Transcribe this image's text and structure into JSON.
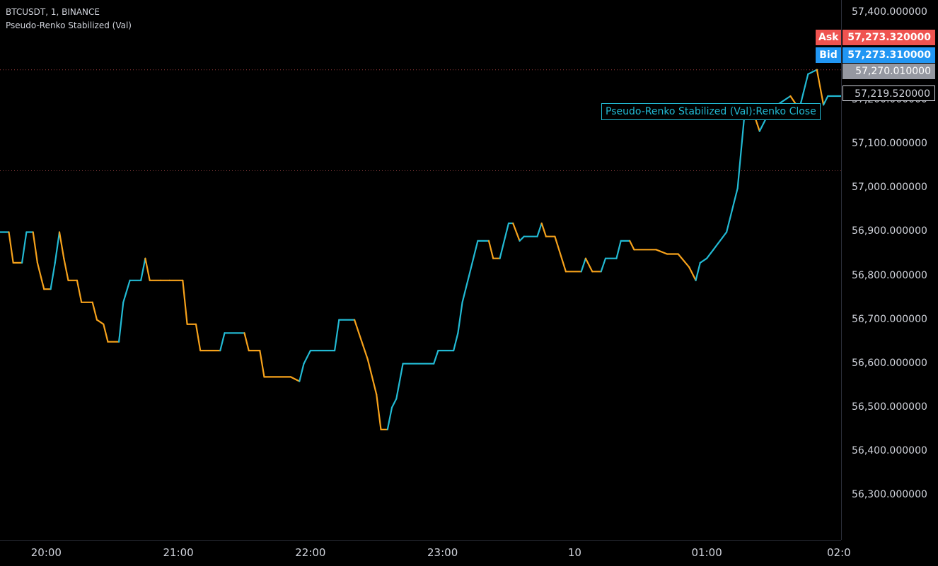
{
  "header": {
    "symbol_line": "BTCUSDT, 1, BINANCE",
    "indicator_line": "Pseudo-Renko Stabilized (Val)"
  },
  "price_scale": {
    "labels": [
      "57,400.000000",
      "57,200.000000",
      "57,100.000000",
      "57,000.000000",
      "56,900.000000",
      "56,800.000000",
      "56,700.000000",
      "56,600.000000",
      "56,500.000000",
      "56,400.000000",
      "56,300.000000"
    ]
  },
  "time_scale": {
    "labels": [
      "20:00",
      "21:00",
      "22:00",
      "23:00",
      "10",
      "01:00",
      "02:0"
    ]
  },
  "tags": {
    "ask_label": "Ask",
    "ask_price": "57,273.320000",
    "bid_label": "Bid",
    "bid_price": "57,273.310000",
    "last_price": "57,270.010000",
    "renko_price": "57,219.520000",
    "renko_callout": "Pseudo-Renko Stabilized (Val):Renko Close"
  },
  "colors": {
    "background": "#000000",
    "renko_up": "#22bad4",
    "renko_down": "#f7a21b",
    "ask": "#ef5350",
    "bid": "#2196f3",
    "last": "#9598a1"
  },
  "chart_data": {
    "type": "line",
    "title": "",
    "xlabel": "",
    "ylabel": "",
    "ylim": [
      56230,
      57430
    ],
    "xlim": [
      "19:39",
      "02:01"
    ],
    "renko_close": [
      [
        "19:39",
        56900
      ],
      [
        "19:43",
        56900
      ],
      [
        "19:45",
        56830
      ],
      [
        "19:49",
        56830
      ],
      [
        "19:51",
        56900
      ],
      [
        "19:54",
        56900
      ],
      [
        "19:56",
        56830
      ],
      [
        "19:58",
        56790
      ],
      [
        "19:59",
        56770
      ],
      [
        "20:02",
        56770
      ],
      [
        "20:04",
        56830
      ],
      [
        "20:06",
        56900
      ],
      [
        "20:08",
        56840
      ],
      [
        "20:10",
        56790
      ],
      [
        "20:14",
        56790
      ],
      [
        "20:16",
        56740
      ],
      [
        "20:21",
        56740
      ],
      [
        "20:23",
        56700
      ],
      [
        "20:26",
        56690
      ],
      [
        "20:28",
        56650
      ],
      [
        "20:33",
        56650
      ],
      [
        "20:35",
        56740
      ],
      [
        "20:38",
        56790
      ],
      [
        "20:43",
        56790
      ],
      [
        "20:45",
        56840
      ],
      [
        "20:47",
        56790
      ],
      [
        "20:52",
        56790
      ],
      [
        "20:56",
        56790
      ],
      [
        "21:02",
        56790
      ],
      [
        "21:04",
        56690
      ],
      [
        "21:08",
        56690
      ],
      [
        "21:10",
        56630
      ],
      [
        "21:19",
        56630
      ],
      [
        "21:21",
        56670
      ],
      [
        "21:30",
        56670
      ],
      [
        "21:32",
        56630
      ],
      [
        "21:37",
        56630
      ],
      [
        "21:39",
        56570
      ],
      [
        "21:51",
        56570
      ],
      [
        "21:55",
        56560
      ],
      [
        "21:57",
        56600
      ],
      [
        "22:00",
        56630
      ],
      [
        "22:11",
        56630
      ],
      [
        "22:13",
        56700
      ],
      [
        "22:20",
        56700
      ],
      [
        "22:22",
        56670
      ],
      [
        "22:26",
        56610
      ],
      [
        "22:30",
        56530
      ],
      [
        "22:32",
        56450
      ],
      [
        "22:35",
        56450
      ],
      [
        "22:37",
        56500
      ],
      [
        "22:39",
        56520
      ],
      [
        "22:42",
        56600
      ],
      [
        "22:56",
        56600
      ],
      [
        "22:58",
        56630
      ],
      [
        "23:05",
        56630
      ],
      [
        "23:07",
        56670
      ],
      [
        "23:09",
        56740
      ],
      [
        "23:12",
        56800
      ],
      [
        "23:16",
        56880
      ],
      [
        "23:21",
        56880
      ],
      [
        "23:23",
        56840
      ],
      [
        "23:26",
        56840
      ],
      [
        "23:30",
        56920
      ],
      [
        "23:32",
        56920
      ],
      [
        "23:35",
        56880
      ],
      [
        "23:37",
        56890
      ],
      [
        "23:43",
        56890
      ],
      [
        "23:45",
        56920
      ],
      [
        "23:47",
        56890
      ],
      [
        "23:51",
        56890
      ],
      [
        "23:56",
        56810
      ],
      [
        "00:03",
        56810
      ],
      [
        "00:05",
        56840
      ],
      [
        "00:08",
        56810
      ],
      [
        "00:12",
        56810
      ],
      [
        "00:14",
        56840
      ],
      [
        "00:19",
        56840
      ],
      [
        "00:21",
        56880
      ],
      [
        "00:25",
        56880
      ],
      [
        "00:27",
        56860
      ],
      [
        "00:37",
        56860
      ],
      [
        "00:42",
        56850
      ],
      [
        "00:47",
        56850
      ],
      [
        "00:52",
        56820
      ],
      [
        "00:55",
        56790
      ],
      [
        "00:57",
        56830
      ],
      [
        "01:00",
        56840
      ],
      [
        "01:03",
        56860
      ],
      [
        "01:09",
        56900
      ],
      [
        "01:14",
        57000
      ],
      [
        "01:17",
        57160
      ],
      [
        "01:22",
        57160
      ],
      [
        "01:24",
        57130
      ],
      [
        "01:27",
        57160
      ],
      [
        "01:32",
        57190
      ],
      [
        "01:38",
        57210
      ],
      [
        "01:42",
        57180
      ],
      [
        "01:46",
        57260
      ],
      [
        "01:50",
        57270
      ],
      [
        "01:53",
        57190
      ],
      [
        "01:55",
        57210
      ],
      [
        "02:01",
        57210
      ]
    ]
  }
}
